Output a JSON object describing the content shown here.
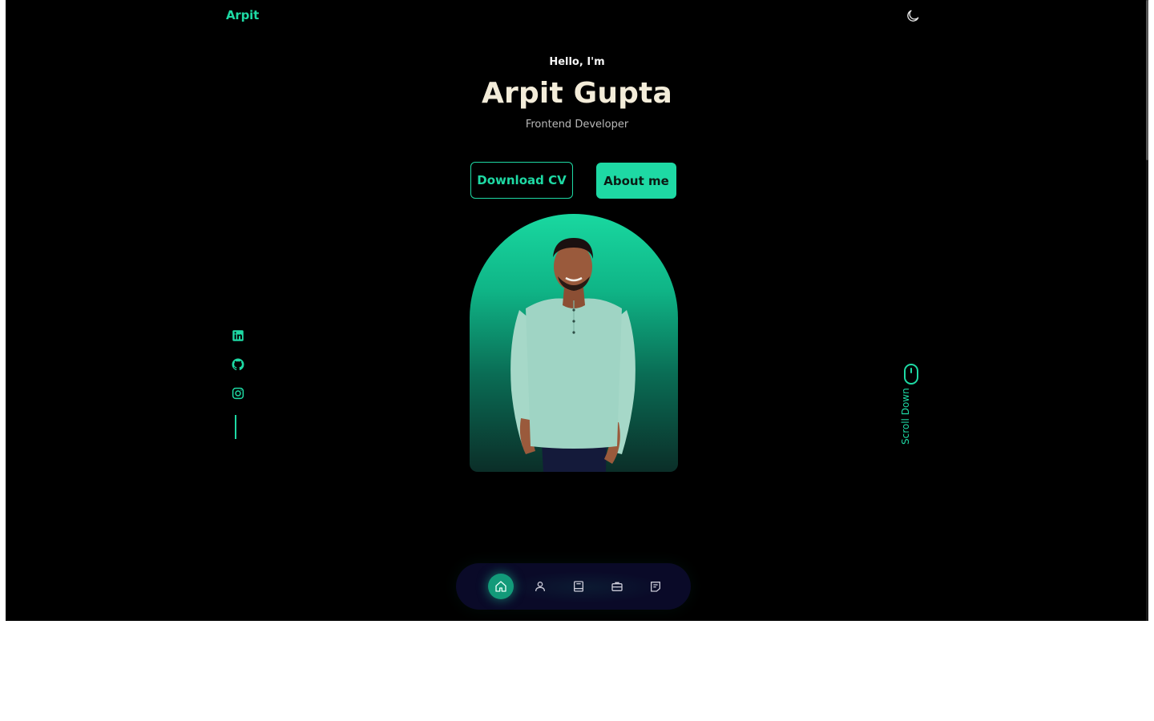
{
  "header": {
    "logo": "Arpit",
    "theme_toggle_icon": "moon-icon"
  },
  "hero": {
    "greeting": "Hello, I'm",
    "name": "Arpit Gupta",
    "role": "Frontend Developer",
    "download_cv_label": "Download CV",
    "about_me_label": "About me",
    "portrait_alt": "Arpit Gupta portrait"
  },
  "socials": {
    "items": [
      {
        "icon": "linkedin-icon"
      },
      {
        "icon": "github-icon"
      },
      {
        "icon": "instagram-icon"
      }
    ]
  },
  "scroll_hint": {
    "label": "Scroll Down",
    "icon": "mouse-icon"
  },
  "bottom_nav": {
    "items": [
      {
        "icon": "home-icon",
        "active": true
      },
      {
        "icon": "user-icon",
        "active": false
      },
      {
        "icon": "book-icon",
        "active": false
      },
      {
        "icon": "briefcase-icon",
        "active": false
      },
      {
        "icon": "message-icon",
        "active": false
      }
    ]
  },
  "colors": {
    "accent": "#1ed9a4",
    "background": "#000000",
    "name_text": "#f3ecd9",
    "nav_background": "#0a0a28"
  }
}
